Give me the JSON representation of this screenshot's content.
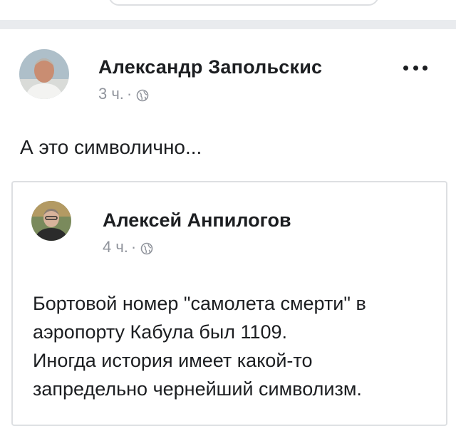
{
  "post": {
    "author": {
      "name": "Александр Запольскис",
      "time": "3 ч.",
      "separator": "·"
    },
    "text": "А это символично...",
    "shared": {
      "author": {
        "name": "Алексей Анпилогов",
        "time": "4 ч.",
        "separator": "·"
      },
      "body_lines": [
        "Бортовой номер \"самолета смерти\" в",
        "аэропорту Кабула был 1109.",
        "Иногда история имеет какой-то",
        "запредельно чернейший символизм."
      ]
    }
  },
  "icons": {
    "privacy": "globe-icon",
    "more": "more-options-icon"
  },
  "colors": {
    "meta_text": "#90949c",
    "separator_bg": "#e9ebee",
    "border": "#dddfe2"
  }
}
